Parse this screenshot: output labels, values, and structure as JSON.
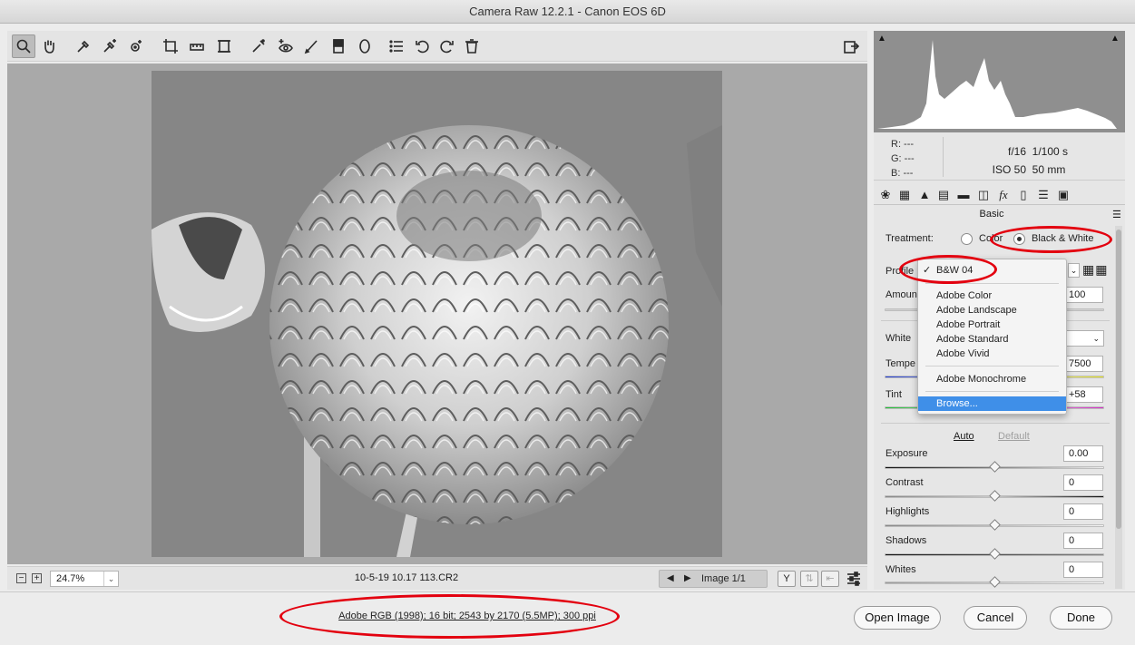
{
  "window": {
    "title": "Camera Raw 12.2.1  -  Canon EOS 6D"
  },
  "toolbar": {
    "tools": [
      "zoom-icon",
      "hand-icon",
      "white-balance-icon",
      "color-sampler-icon",
      "targeted-adjust-icon",
      "crop-icon",
      "straighten-icon",
      "transform-icon",
      "spot-removal-icon",
      "red-eye-icon",
      "brush-icon",
      "graduated-filter-icon",
      "radial-filter-icon",
      "list-icon",
      "rotate-left-icon",
      "rotate-right-icon",
      "trash-icon",
      "export-icon"
    ]
  },
  "status": {
    "zoom_minus": "−",
    "zoom_plus": "+",
    "zoom": "24.7%",
    "filename": "10-5-19 10.17 113.CR2",
    "image_count": "Image 1/1",
    "y_icon": "Y"
  },
  "histogram": {
    "rgb": {
      "r": "R:   ---",
      "g": "G:   ---",
      "b": "B:   ---"
    },
    "aperture": "f/16",
    "shutter": "1/100 s",
    "iso": "ISO 50",
    "focal": "50 mm"
  },
  "panel": {
    "title": "Basic",
    "treatment_label": "Treatment:",
    "color_label": "Color",
    "bw_label": "Black & White",
    "profile_label": "Profile",
    "amount_label": "Amount",
    "amount_value": "100",
    "wb_label": "White",
    "temp_label": "Tempe",
    "temp_value": "7500",
    "tint_label": "Tint",
    "tint_value": "+58",
    "auto_label": "Auto",
    "default_label": "Default",
    "sliders": [
      {
        "label": "Exposure",
        "value": "0.00"
      },
      {
        "label": "Contrast",
        "value": "0"
      },
      {
        "label": "Highlights",
        "value": "0"
      },
      {
        "label": "Shadows",
        "value": "0"
      },
      {
        "label": "Whites",
        "value": "0"
      }
    ]
  },
  "profile_menu": {
    "checked": "B&W 04",
    "items": [
      "Adobe Color",
      "Adobe Landscape",
      "Adobe Portrait",
      "Adobe Standard",
      "Adobe Vivid"
    ],
    "monochrome": "Adobe Monochrome",
    "browse": "Browse..."
  },
  "footer": {
    "workflow_link": "Adobe RGB (1998); 16 bit; 2543 by 2170 (5.5MP); 300 ppi",
    "open_image": "Open Image",
    "cancel": "Cancel",
    "done": "Done"
  },
  "colors": {
    "annotation": "#e3000f",
    "menu_highlight": "#3f8fe8"
  }
}
